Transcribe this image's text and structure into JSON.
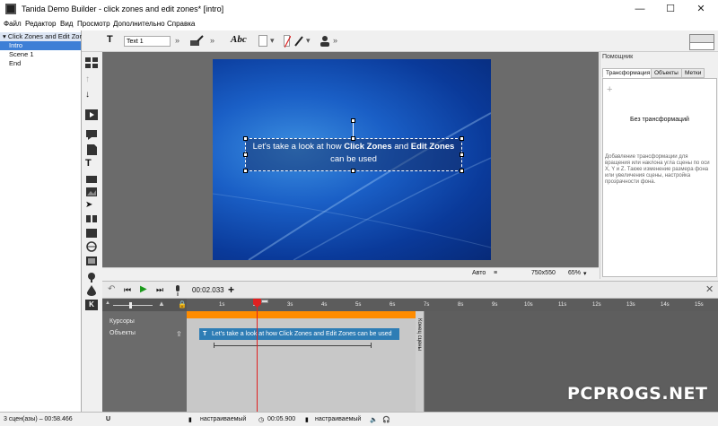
{
  "window": {
    "title": "Tanida Demo Builder - click zones and edit zones* [intro]",
    "controls": {
      "minimize": "—",
      "maximize": "☐",
      "close": "✕"
    }
  },
  "menu": [
    "Файл",
    "Редактор",
    "Вид",
    "Просмотр",
    "Дополнительно",
    "Справка"
  ],
  "tree": {
    "root": "Click Zones and Edit Zones",
    "items": [
      "Intro",
      "Scene 1",
      "End"
    ],
    "selected_index": 0
  },
  "toolbar": {
    "text_icon": "T",
    "name_value": "Text 1",
    "style_label": "Abc"
  },
  "tools": [
    "layout-icon",
    "up-arrow-icon",
    "down-arrow-icon",
    "play-icon",
    "comment-icon",
    "page-icon",
    "text-icon",
    "rect-icon",
    "image-icon",
    "cursor-icon",
    "flip-icon",
    "audio-icon",
    "globe-icon",
    "film-icon",
    "pin-icon",
    "drop-icon",
    "k-icon"
  ],
  "slide": {
    "text_part1": "Let's take a look at how ",
    "text_bold1": "Click Zones",
    "text_part2": " and ",
    "text_bold2": "Edit Zones",
    "text_part3": " can be used"
  },
  "canvas_status": {
    "auto": "Авто",
    "size": "750x550",
    "zoom": "65%"
  },
  "panel": {
    "title": "Помощник",
    "tabs": [
      "Трансформация",
      "Объекты",
      "Метки"
    ],
    "add": "+",
    "no_transform": "Без трансформаций",
    "hint": "Добавление трансформации для вращения или наклона угла сцены по оси X, Y и Z. Также изменение размера фона или увеличения сцены, настройка прозрачности фона."
  },
  "timeline": {
    "time": "00:02.033",
    "add": "+",
    "ticks": [
      "1s",
      "2s",
      "3s",
      "4s",
      "5s",
      "6s",
      "7s",
      "8s",
      "9s",
      "10s",
      "11s",
      "12s",
      "13s",
      "14s",
      "15s"
    ],
    "tracks": [
      "Курсоры",
      "Объекты"
    ],
    "clip_text": "Let's take a look at how Click Zones and Edit Zones can be used",
    "scene_end": "Конец сцены"
  },
  "statusbar": {
    "scenes": "3 сцен(азы) – 00:58.466",
    "u": "U",
    "mode1": "настраиваемый",
    "time": "00:05.900",
    "mode2": "настраиваемый"
  },
  "watermark": "PCPROGS.NET"
}
